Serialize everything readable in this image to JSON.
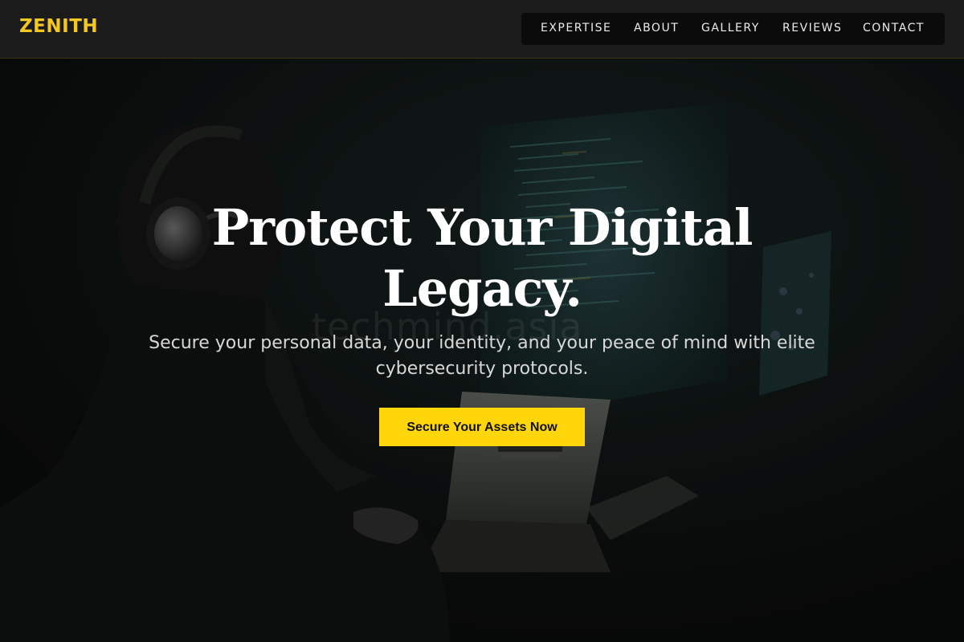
{
  "brand": {
    "name": "ZENITH",
    "color": "#f4c820"
  },
  "nav": {
    "items": [
      {
        "label": "EXPERTISE"
      },
      {
        "label": "ABOUT"
      },
      {
        "label": "GALLERY"
      },
      {
        "label": "REVIEWS"
      },
      {
        "label": "CONTACT"
      }
    ]
  },
  "hero": {
    "headline_line1": "Protect Your Digital",
    "headline_line2": "Legacy.",
    "subheading_line1": "Secure your personal data, your identity, and your peace of mind with elite",
    "subheading_line2": "cybersecurity protocols.",
    "cta_label": "Secure Your Assets Now",
    "cta_color": "#ffd60a",
    "watermark": "techmind.asia",
    "background_image": "person-with-headphones-at-computer-screens"
  }
}
